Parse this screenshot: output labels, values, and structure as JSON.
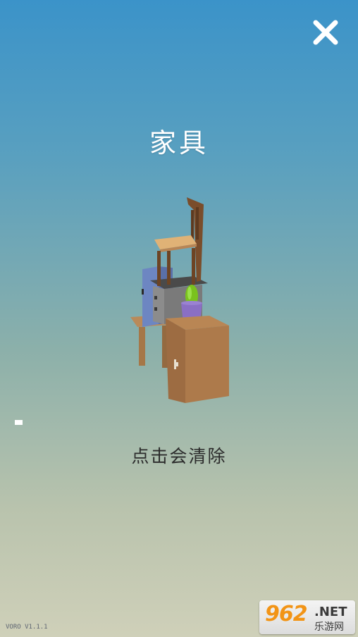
{
  "header": {
    "title": "家具",
    "close_icon": "close-icon"
  },
  "scene": {
    "objects": [
      "chair-icon",
      "cabinet-icon",
      "table-icon",
      "safe-icon",
      "plant-pot-icon"
    ]
  },
  "hint": {
    "text": "点击会清除"
  },
  "footer": {
    "version": "VORO V1.1.1",
    "watermark_number": "962",
    "watermark_net": ".NET",
    "watermark_cn": "乐游网"
  },
  "colors": {
    "sky_top": "#3b93c9",
    "sky_bottom": "#cfd0b9",
    "title": "#ffffff",
    "hint": "#2b2b2b"
  }
}
